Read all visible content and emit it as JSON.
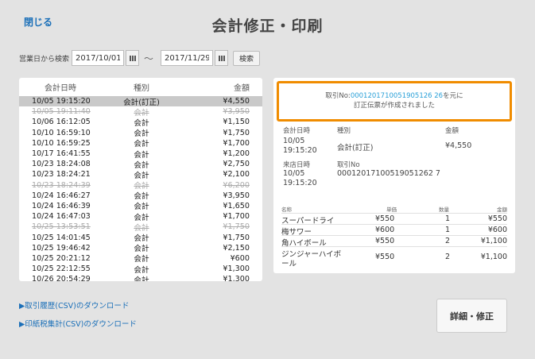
{
  "header": {
    "close_label": "閉じる",
    "title": "会計修正・印刷"
  },
  "search": {
    "label": "営業日から検索",
    "from_date": "2017/10/01",
    "tilde": "〜",
    "to_date": "2017/11/29",
    "button": "検索"
  },
  "list": {
    "columns": [
      "会計日時",
      "種別",
      "金額"
    ],
    "rows": [
      {
        "datetime": "10/05 19:15:20",
        "type": "会計(訂正)",
        "amount": "¥4,550",
        "state": "selected"
      },
      {
        "datetime": "10/05 19:11:40",
        "type": "会計",
        "amount": "¥3,950",
        "state": "cancelled"
      },
      {
        "datetime": "10/06 16:12:05",
        "type": "会計",
        "amount": "¥1,150",
        "state": ""
      },
      {
        "datetime": "10/10 16:59:10",
        "type": "会計",
        "amount": "¥1,750",
        "state": ""
      },
      {
        "datetime": "10/10 16:59:25",
        "type": "会計",
        "amount": "¥1,700",
        "state": ""
      },
      {
        "datetime": "10/17 16:41:55",
        "type": "会計",
        "amount": "¥1,200",
        "state": ""
      },
      {
        "datetime": "10/23 18:24:08",
        "type": "会計",
        "amount": "¥2,750",
        "state": ""
      },
      {
        "datetime": "10/23 18:24:21",
        "type": "会計",
        "amount": "¥2,100",
        "state": ""
      },
      {
        "datetime": "10/23 18:24:39",
        "type": "会計",
        "amount": "¥6,200",
        "state": "cancelled"
      },
      {
        "datetime": "10/24 16:46:27",
        "type": "会計",
        "amount": "¥3,950",
        "state": ""
      },
      {
        "datetime": "10/24 16:46:39",
        "type": "会計",
        "amount": "¥1,650",
        "state": ""
      },
      {
        "datetime": "10/24 16:47:03",
        "type": "会計",
        "amount": "¥1,700",
        "state": ""
      },
      {
        "datetime": "10/25 13:53:51",
        "type": "会計",
        "amount": "¥1,750",
        "state": "cancelled"
      },
      {
        "datetime": "10/25 14:01:45",
        "type": "会計",
        "amount": "¥1,750",
        "state": ""
      },
      {
        "datetime": "10/25 19:46:42",
        "type": "会計",
        "amount": "¥2,150",
        "state": ""
      },
      {
        "datetime": "10/25 20:21:12",
        "type": "会計",
        "amount": "¥600",
        "state": ""
      },
      {
        "datetime": "10/25 22:12:55",
        "type": "会計",
        "amount": "¥1,300",
        "state": ""
      },
      {
        "datetime": "10/26 20:54:29",
        "type": "会計",
        "amount": "¥1,300",
        "state": ""
      }
    ]
  },
  "detail": {
    "notice_prefix": "取引No:",
    "notice_id": "0001201710051905126 26",
    "notice_suffix": "を元に",
    "notice_line2": "訂正伝票が作成されました",
    "labels": {
      "datetime": "会計日時",
      "type": "種別",
      "amount": "金額",
      "visit": "来店日時",
      "txno": "取引No"
    },
    "datetime_l1": "10/05",
    "datetime_l2": "19:15:20",
    "type": "会計(訂正)",
    "amount": "¥4,550",
    "visit_l1": "10/05",
    "visit_l2": "19:15:20",
    "txno": "00012017100519051262 7",
    "item_columns": {
      "name": "名称",
      "price": "単価",
      "qty": "数量",
      "amount": "金額"
    },
    "items": [
      {
        "name": "スーパードライ",
        "name2": "",
        "price": "¥550",
        "qty": "1",
        "amount": "¥550"
      },
      {
        "name": "梅サワー",
        "name2": "",
        "price": "¥600",
        "qty": "1",
        "amount": "¥600"
      },
      {
        "name": "角ハイボール",
        "name2": "",
        "price": "¥550",
        "qty": "2",
        "amount": "¥1,100"
      },
      {
        "name": "ジンジャーハイボ",
        "name2": "ール",
        "price": "¥550",
        "qty": "2",
        "amount": "¥1,100"
      }
    ]
  },
  "downloads": {
    "history": "▶取引履歴(CSV)のダウンロード",
    "stamp": "▶印紙税集計(CSV)のダウンロード"
  },
  "edit_button": "詳細・修正"
}
